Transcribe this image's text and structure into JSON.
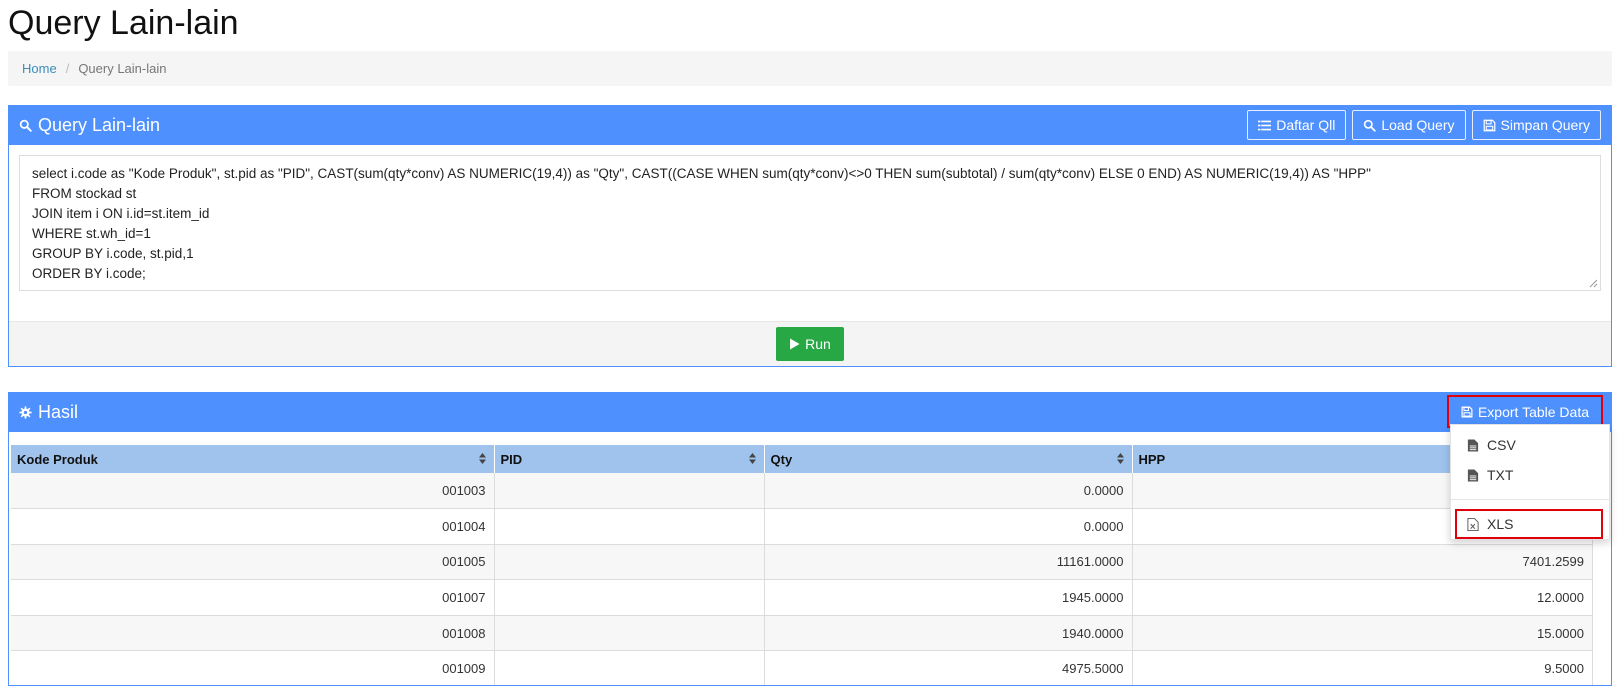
{
  "page": {
    "title": "Query Lain-lain"
  },
  "breadcrumb": {
    "home": "Home",
    "current": "Query Lain-lain"
  },
  "query_panel": {
    "title": "Query Lain-lain",
    "buttons": {
      "daftar": "Daftar Qll",
      "load": "Load Query",
      "simpan": "Simpan Query"
    },
    "query_lines": [
      "select i.code as \"Kode Produk\", st.pid as \"PID\", CAST(sum(qty*conv) AS NUMERIC(19,4)) as \"Qty\", CAST((CASE WHEN sum(qty*conv)<>0 THEN sum(subtotal) / sum(qty*conv) ELSE 0 END) AS NUMERIC(19,4)) AS \"HPP\"",
      "FROM stockad st",
      "JOIN item i ON i.id=st.item_id",
      "WHERE st.wh_id=1",
      "GROUP BY i.code, st.pid,1",
      "ORDER BY i.code;"
    ],
    "run_label": "Run"
  },
  "result_panel": {
    "title": "Hasil",
    "export_label": "Export Table Data",
    "columns": [
      "Kode Produk",
      "PID",
      "Qty",
      "HPP"
    ],
    "rows": [
      {
        "kode": "001003",
        "pid": "",
        "qty": "0.0000",
        "hpp": ""
      },
      {
        "kode": "001004",
        "pid": "",
        "qty": "0.0000",
        "hpp": ""
      },
      {
        "kode": "001005",
        "pid": "",
        "qty": "11161.0000",
        "hpp": "7401.2599"
      },
      {
        "kode": "001007",
        "pid": "",
        "qty": "1945.0000",
        "hpp": "12.0000"
      },
      {
        "kode": "001008",
        "pid": "",
        "qty": "1940.0000",
        "hpp": "15.0000"
      },
      {
        "kode": "001009",
        "pid": "",
        "qty": "4975.5000",
        "hpp": "9.5000"
      }
    ]
  },
  "export_menu": {
    "csv": "CSV",
    "txt": "TXT",
    "xls": "XLS"
  },
  "colors": {
    "accent": "#4d90fe",
    "header_row": "#9fc3ec",
    "run": "#28a745",
    "highlight": "#e0000b",
    "link": "#3c8dbc"
  }
}
